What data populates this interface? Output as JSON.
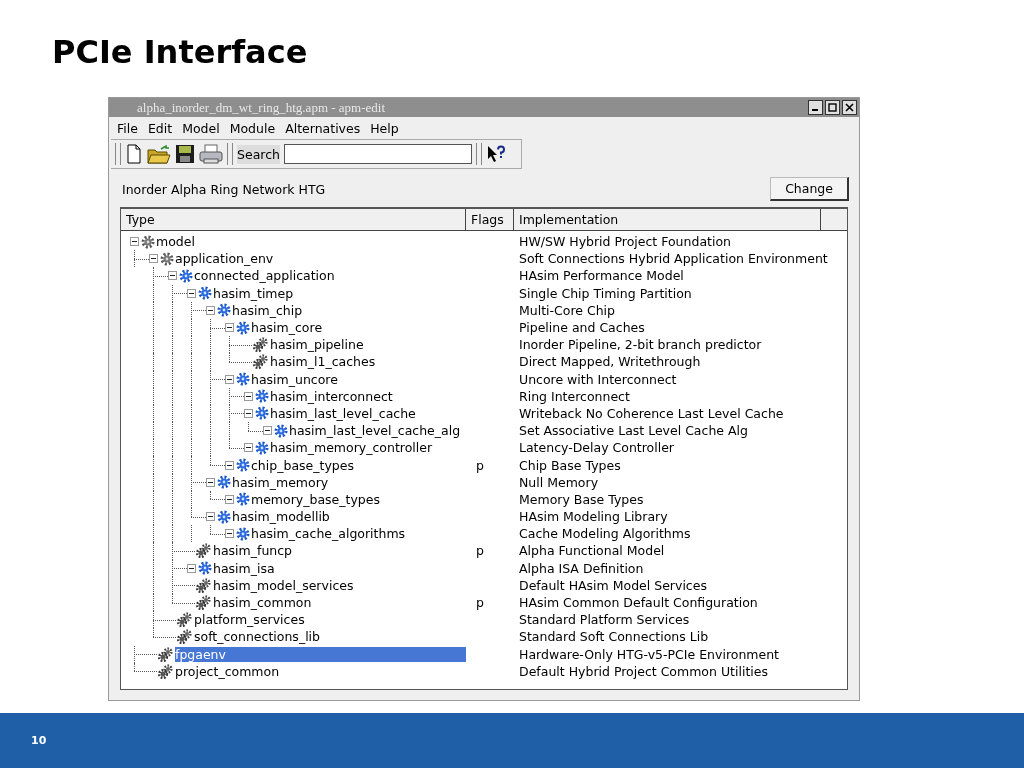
{
  "slide": {
    "title": "PCIe Interface",
    "page_number": "10"
  },
  "window": {
    "title": "alpha_inorder_dm_wt_ring_htg.apm - apm-edit",
    "menu": [
      "File",
      "Edit",
      "Model",
      "Module",
      "Alternatives",
      "Help"
    ],
    "search_label": "Search",
    "model_name": "Inorder Alpha Ring Network HTG",
    "change_button": "Change",
    "columns": [
      "Type",
      "Flags",
      "Implementation"
    ],
    "tree": [
      {
        "name": "model",
        "kind": "root",
        "expanded": true,
        "selected": false,
        "implementation": "HW/SW Hybrid Project Foundation",
        "children": [
          {
            "name": "application_env",
            "kind": "root",
            "expanded": true,
            "selected": false,
            "implementation": "Soft Connections Hybrid Application Environment",
            "children": [
              {
                "name": "connected_application",
                "kind": "module",
                "expanded": true,
                "selected": false,
                "implementation": "HAsim Performance Model",
                "children": [
                  {
                    "name": "hasim_timep",
                    "kind": "module",
                    "expanded": true,
                    "selected": false,
                    "implementation": "Single Chip Timing Partition",
                    "children": [
                      {
                        "name": "hasim_chip",
                        "kind": "module",
                        "expanded": true,
                        "selected": false,
                        "implementation": "Multi-Core Chip",
                        "children": [
                          {
                            "name": "hasim_core",
                            "kind": "module",
                            "expanded": true,
                            "selected": false,
                            "implementation": "Pipeline and Caches",
                            "children": [
                              {
                                "name": "hasim_pipeline",
                                "kind": "leaf",
                                "selected": false,
                                "implementation": "Inorder Pipeline, 2-bit branch predictor"
                              },
                              {
                                "name": "hasim_l1_caches",
                                "kind": "leaf",
                                "selected": false,
                                "implementation": "Direct Mapped, Writethrough"
                              }
                            ]
                          },
                          {
                            "name": "hasim_uncore",
                            "kind": "module",
                            "expanded": true,
                            "selected": false,
                            "implementation": "Uncore with Interconnect",
                            "children": [
                              {
                                "name": "hasim_interconnect",
                                "kind": "module",
                                "expanded": true,
                                "selected": false,
                                "implementation": "Ring Interconnect"
                              },
                              {
                                "name": "hasim_last_level_cache",
                                "kind": "module",
                                "expanded": true,
                                "selected": false,
                                "implementation": "Writeback No Coherence Last Level Cache",
                                "children": [
                                  {
                                    "name": "hasim_last_level_cache_alg",
                                    "kind": "module",
                                    "expanded": true,
                                    "selected": false,
                                    "implementation": "Set Associative Last Level Cache Alg"
                                  }
                                ]
                              },
                              {
                                "name": "hasim_memory_controller",
                                "kind": "module",
                                "expanded": true,
                                "selected": false,
                                "implementation": "Latency-Delay Controller"
                              }
                            ]
                          },
                          {
                            "name": "chip_base_types",
                            "kind": "module",
                            "expanded": true,
                            "selected": false,
                            "flags": "p",
                            "implementation": "Chip Base Types"
                          }
                        ]
                      },
                      {
                        "name": "hasim_memory",
                        "kind": "module",
                        "expanded": true,
                        "selected": false,
                        "implementation": "Null Memory",
                        "children": [
                          {
                            "name": "memory_base_types",
                            "kind": "module",
                            "expanded": true,
                            "selected": false,
                            "implementation": "Memory Base Types"
                          }
                        ]
                      },
                      {
                        "name": "hasim_modellib",
                        "kind": "module",
                        "expanded": true,
                        "selected": false,
                        "implementation": "HAsim Modeling Library",
                        "children": [
                          {
                            "name": "hasim_cache_algorithms",
                            "kind": "module",
                            "expanded": true,
                            "selected": false,
                            "implementation": "Cache Modeling Algorithms"
                          }
                        ]
                      }
                    ]
                  },
                  {
                    "name": "hasim_funcp",
                    "kind": "leaf",
                    "selected": false,
                    "flags": "p",
                    "implementation": "Alpha Functional Model"
                  },
                  {
                    "name": "hasim_isa",
                    "kind": "module",
                    "expanded": true,
                    "selected": false,
                    "implementation": "Alpha ISA Definition"
                  },
                  {
                    "name": "hasim_model_services",
                    "kind": "leaf",
                    "selected": false,
                    "implementation": "Default HAsim Model Services"
                  },
                  {
                    "name": "hasim_common",
                    "kind": "leaf",
                    "selected": false,
                    "flags": "p",
                    "implementation": "HAsim Common Default Configuration"
                  }
                ]
              },
              {
                "name": "platform_services",
                "kind": "leaf",
                "selected": false,
                "implementation": "Standard Platform Services"
              },
              {
                "name": "soft_connections_lib",
                "kind": "leaf",
                "selected": false,
                "implementation": "Standard Soft Connections Lib"
              }
            ]
          },
          {
            "name": "fpgaenv",
            "kind": "leaf",
            "selected": true,
            "implementation": "Hardware-Only HTG-v5-PCIe Environment"
          },
          {
            "name": "project_common",
            "kind": "leaf",
            "selected": false,
            "implementation": "Default Hybrid Project Common Utilities"
          }
        ]
      }
    ]
  }
}
